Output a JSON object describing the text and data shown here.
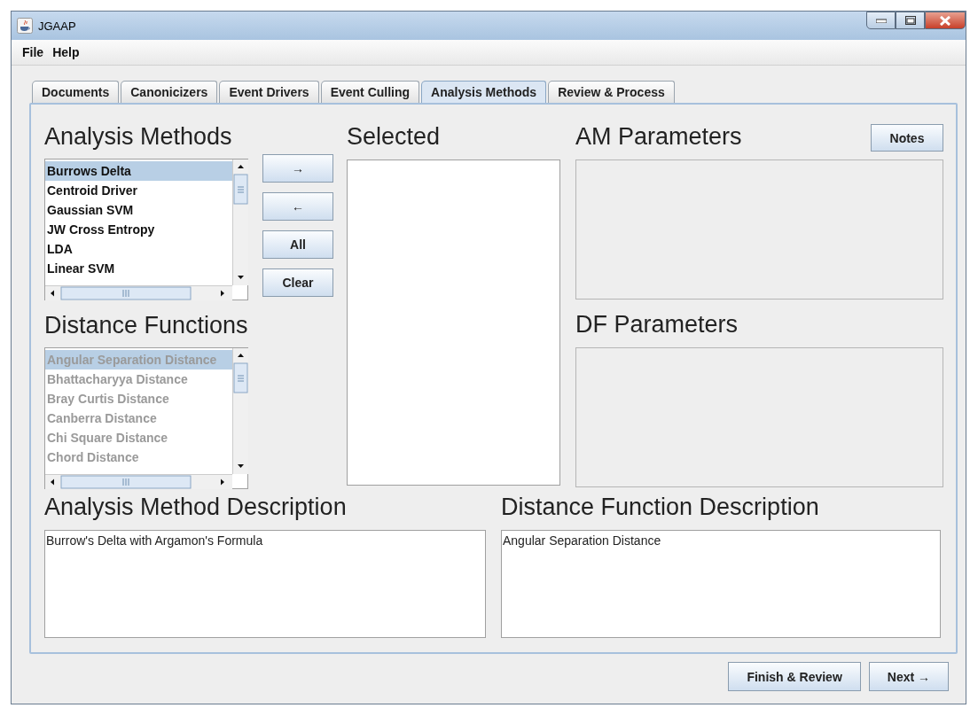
{
  "window": {
    "title": "JGAAP"
  },
  "menu": [
    "File",
    "Help"
  ],
  "tabs": [
    {
      "label": "Documents",
      "selected": false
    },
    {
      "label": "Canonicizers",
      "selected": false
    },
    {
      "label": "Event Drivers",
      "selected": false
    },
    {
      "label": "Event Culling",
      "selected": false
    },
    {
      "label": "Analysis Methods",
      "selected": true
    },
    {
      "label": "Review & Process",
      "selected": false
    }
  ],
  "analysis_methods": {
    "heading": "Analysis Methods",
    "disabled": false,
    "items": [
      {
        "label": "Burrows Delta",
        "selected": true
      },
      {
        "label": "Centroid Driver",
        "selected": false
      },
      {
        "label": "Gaussian SVM",
        "selected": false
      },
      {
        "label": "JW Cross Entropy",
        "selected": false
      },
      {
        "label": "LDA",
        "selected": false
      },
      {
        "label": "Linear SVM",
        "selected": false
      }
    ]
  },
  "move_buttons": [
    "→",
    "←",
    "All",
    "Clear"
  ],
  "selected_panel": {
    "heading": "Selected"
  },
  "distance_functions": {
    "heading": "Distance Functions",
    "disabled": true,
    "items": [
      {
        "label": "Angular Separation Distance",
        "selected": true
      },
      {
        "label": "Bhattacharyya Distance",
        "selected": false
      },
      {
        "label": "Bray Curtis Distance",
        "selected": false
      },
      {
        "label": "Canberra Distance",
        "selected": false
      },
      {
        "label": "Chi Square Distance",
        "selected": false
      },
      {
        "label": "Chord Distance",
        "selected": false
      }
    ]
  },
  "am_parameters": {
    "heading": "AM Parameters",
    "button": "Notes"
  },
  "df_parameters": {
    "heading": "DF Parameters"
  },
  "am_description": {
    "heading": "Analysis Method Description",
    "text": "Burrow's Delta with Argamon's Formula"
  },
  "df_description": {
    "heading": "Distance Function Description",
    "text": "Angular Separation Distance"
  },
  "footer_buttons": [
    "Finish & Review",
    "Next →"
  ]
}
